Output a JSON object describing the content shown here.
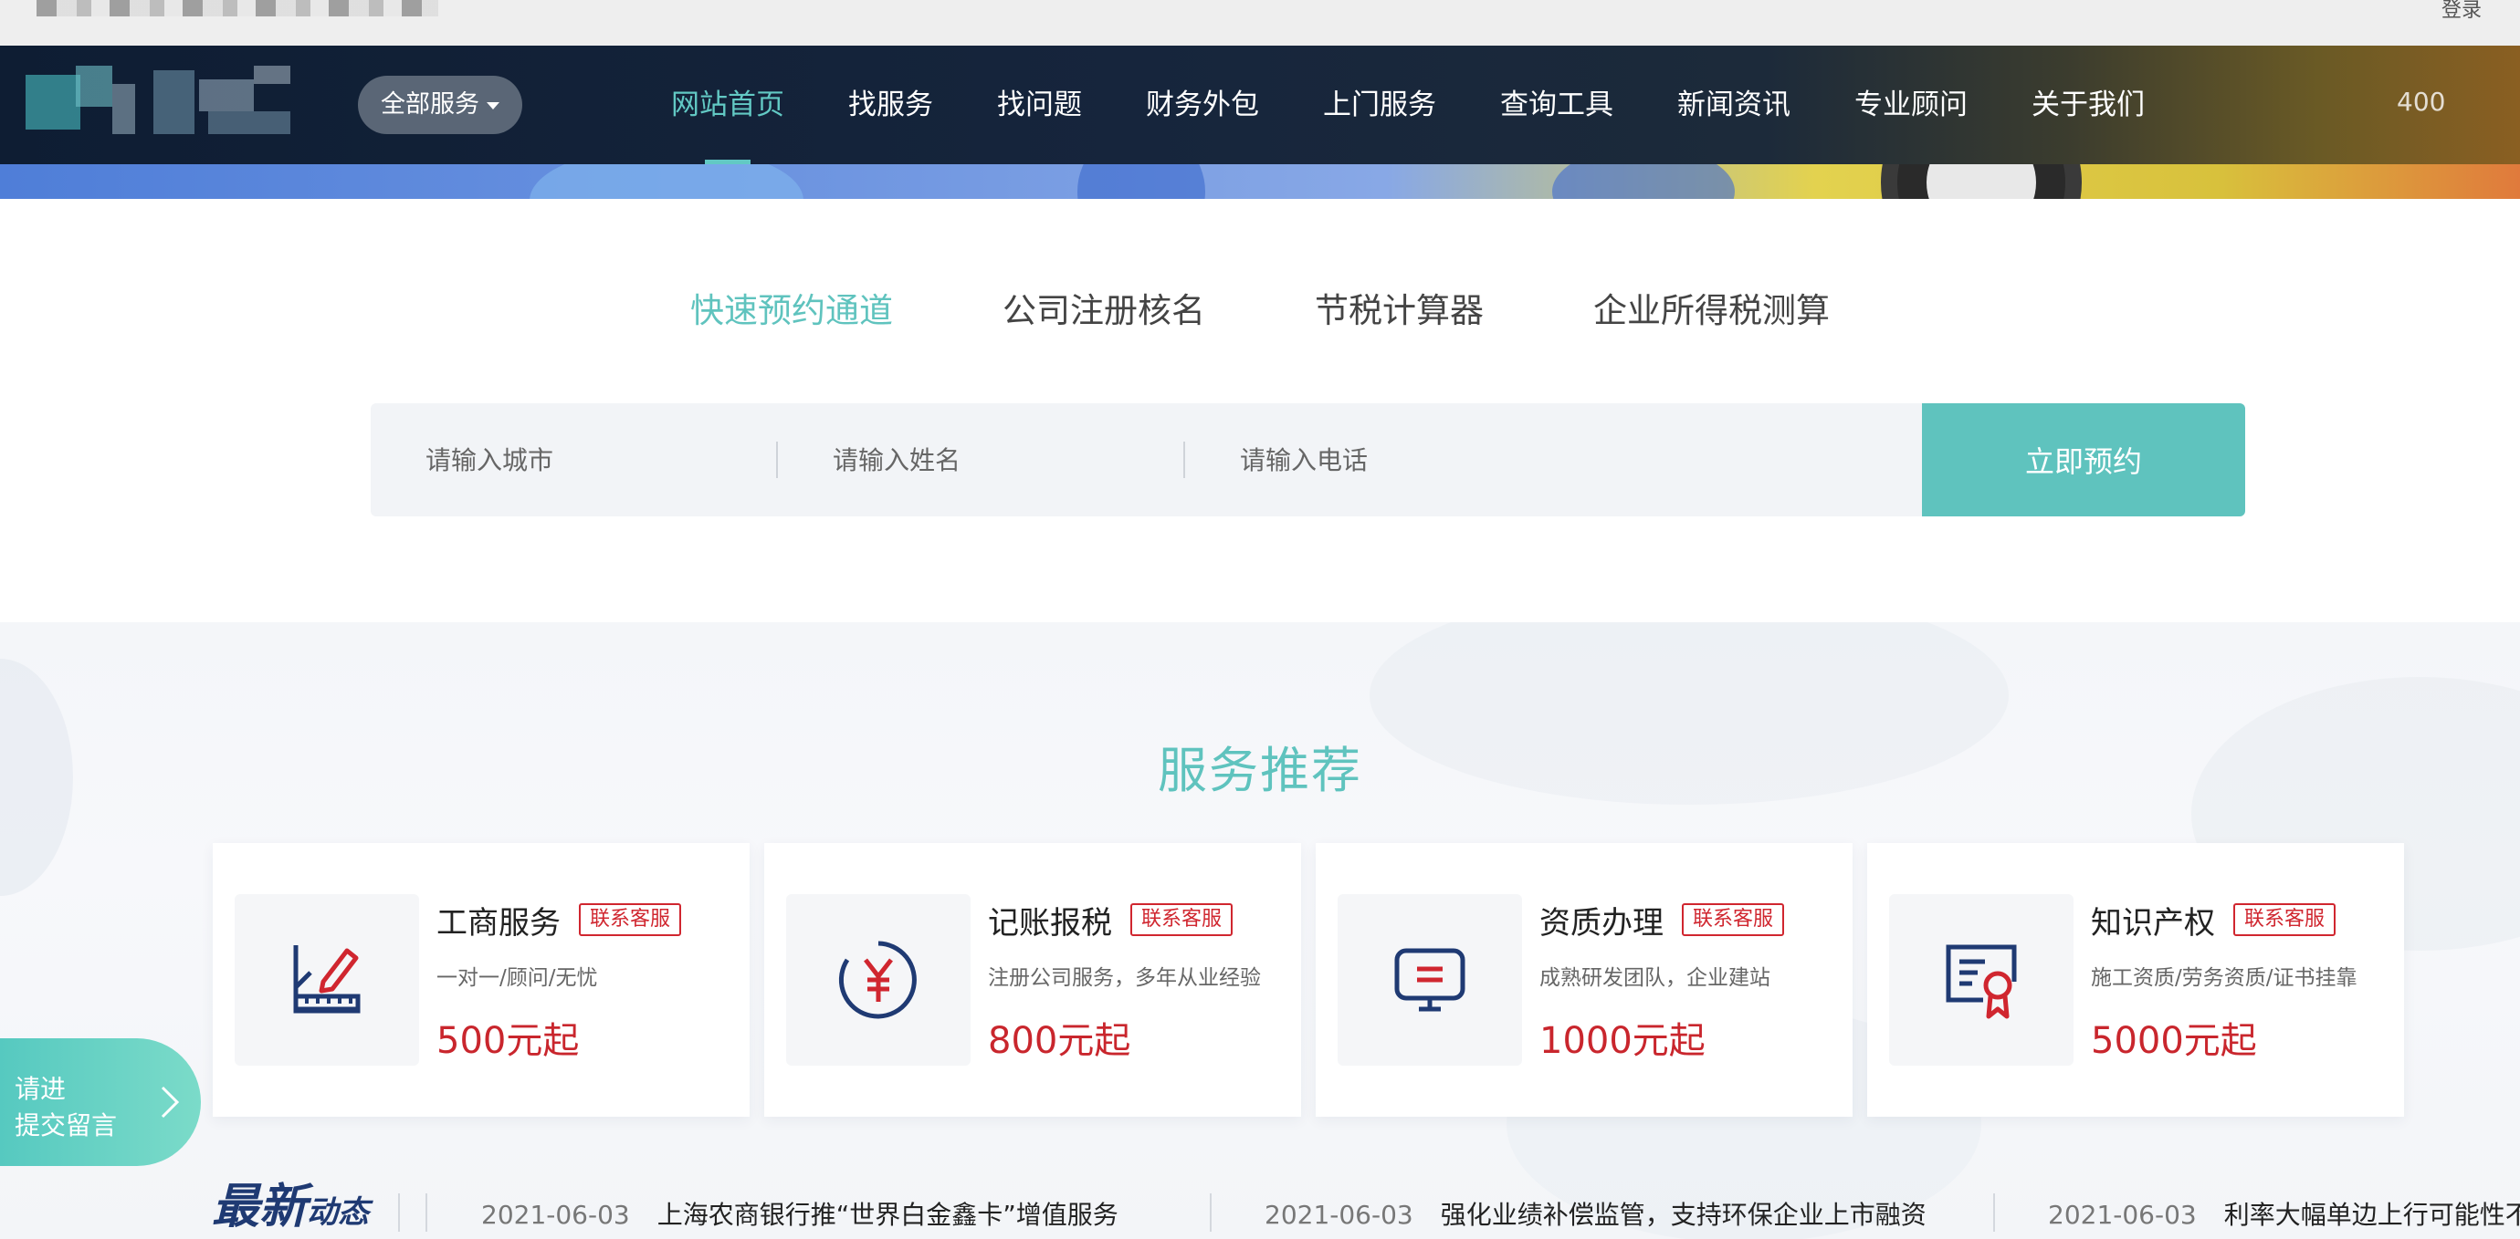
{
  "topbar": {
    "login": "登录"
  },
  "nav": {
    "all_services": "全部服务",
    "items": [
      "网站首页",
      "找服务",
      "找问题",
      "财务外包",
      "上门服务",
      "查询工具",
      "新闻资讯",
      "专业顾问",
      "关于我们"
    ],
    "active_index": 0,
    "extra": "400"
  },
  "quick_tabs": [
    "快速预约通道",
    "公司注册核名",
    "节税计算器",
    "企业所得税测算"
  ],
  "booking": {
    "city_placeholder": "请输入城市",
    "name_placeholder": "请输入姓名",
    "phone_placeholder": "请输入电话",
    "submit": "立即预约"
  },
  "services": {
    "title": "服务推荐",
    "cards": [
      {
        "name": "工商服务",
        "badge": "联系客服",
        "desc": "一对一/顾问/无忧",
        "price": "500元起",
        "icon": "ruler-pencil-icon"
      },
      {
        "name": "记账报税",
        "badge": "联系客服",
        "desc": "注册公司服务，多年从业经验",
        "price": "800元起",
        "icon": "yen-circle-icon"
      },
      {
        "name": "资质办理",
        "badge": "联系客服",
        "desc": "成熟研发团队，企业建站",
        "price": "1000元起",
        "icon": "monitor-icon"
      },
      {
        "name": "知识产权",
        "badge": "联系客服",
        "desc": "施工资质/劳务资质/证书挂靠",
        "price": "5000元起",
        "icon": "certificate-icon"
      }
    ]
  },
  "float_message": {
    "line1": "请进",
    "line2": "提交留言"
  },
  "news": {
    "label_big": "最新",
    "label_small": "动态",
    "items": [
      {
        "date": "2021-06-03",
        "title": "上海农商银行推“世界白金鑫卡”增值服务"
      },
      {
        "date": "2021-06-03",
        "title": "强化业绩补偿监管，支持环保企业上市融资"
      },
      {
        "date": "2021-06-03",
        "title": "利率大幅单边上行可能性不大"
      }
    ]
  },
  "colors": {
    "accent": "#5fc3be",
    "nav_bg": "#0e1d33",
    "price": "#c9262d",
    "badge": "#d0262f",
    "news_label": "#1f3a73"
  }
}
